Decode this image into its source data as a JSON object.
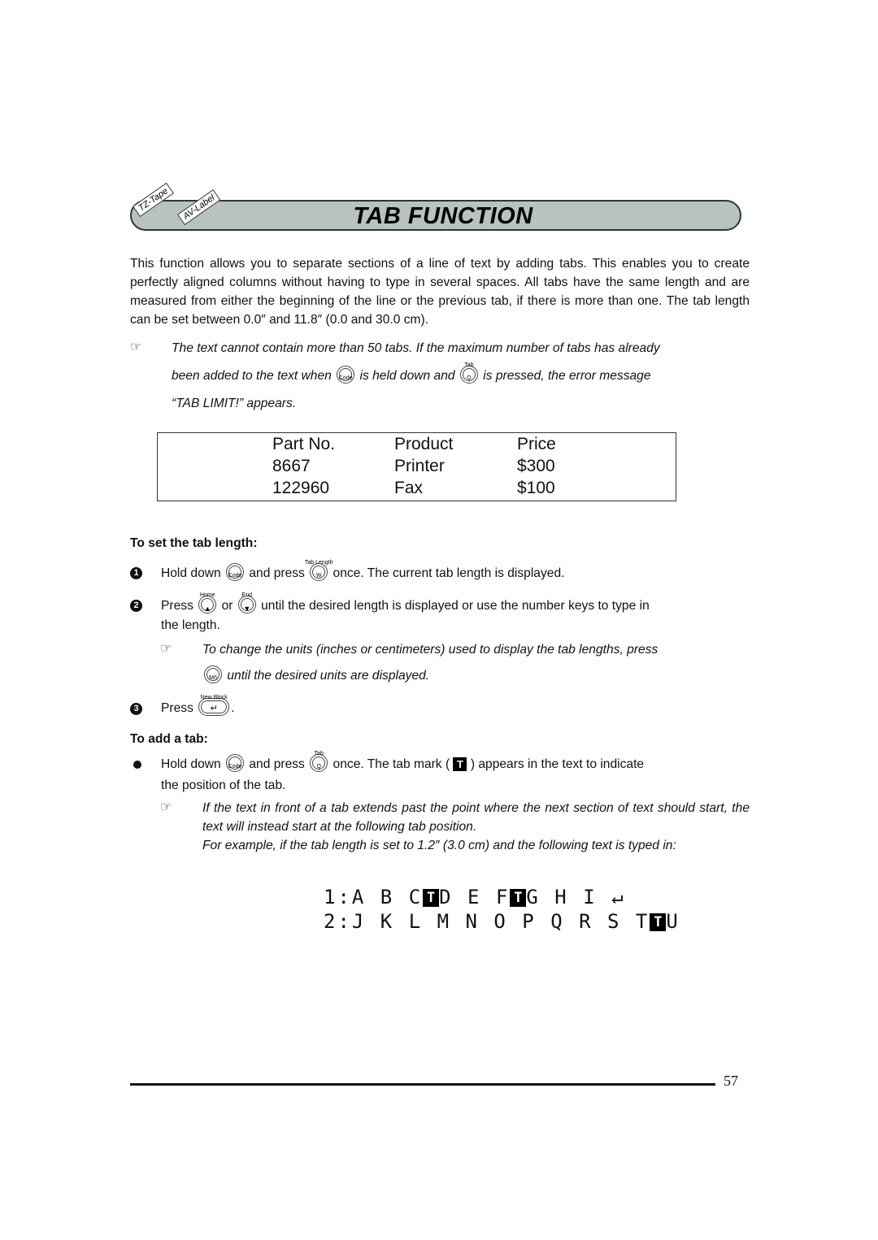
{
  "header": {
    "title": "TAB FUNCTION",
    "tags": [
      "TZ-Tape",
      "AV-Label"
    ]
  },
  "intro": "This function allows you to separate sections of a line of text by adding tabs. This enables you to create perfectly aligned columns without having to type in several spaces. All tabs have the same length and are measured from either the beginning of the line or the previous tab, if there is more than one. The tab length can be set between 0.0″ and 11.8″ (0.0 and 30.0 cm).",
  "note1": {
    "part1": "The text cannot contain more than 50 tabs. If the maximum number of tabs has already",
    "part2": "been added to the text when",
    "part3": "is held down and",
    "part4": "is pressed, the error message",
    "part5": "“TAB LIMIT!” appears."
  },
  "keys": {
    "code": "Code",
    "q": "Q",
    "q_sup": "Tab",
    "w": "W",
    "w_sup": "Tab Length",
    "up_sup": "Home",
    "down_sup": "End",
    "mn": "Mñ",
    "enter_sup": "New Block",
    "enter": "↵",
    "up": "▲",
    "down": "▼"
  },
  "example_table": {
    "headers": [
      "Part No.",
      "Product",
      "Price"
    ],
    "rows": [
      [
        "8667",
        "Printer",
        "$300"
      ],
      [
        "122960",
        "Fax",
        "$100"
      ]
    ]
  },
  "set_length": {
    "heading": "To set the tab length:",
    "step1": {
      "num": "1",
      "a": "Hold down",
      "b": "and press",
      "c": "once. The current tab length is displayed."
    },
    "step2": {
      "num": "2",
      "a": "Press",
      "b": "or",
      "c": "until the desired length is displayed or use the number keys to type in",
      "d": "the length."
    },
    "note": {
      "a": "To change the units (inches or centimeters) used to display the tab lengths, press",
      "b": "until the desired units are displayed."
    },
    "step3": {
      "num": "3",
      "a": "Press",
      "b": "."
    }
  },
  "add_tab": {
    "heading": "To add a tab:",
    "bullet": {
      "a": "Hold down",
      "b": "and press",
      "c": "once. The tab mark (",
      "d": ") appears in the text to indicate",
      "e": "the position of the tab."
    },
    "tab_glyph": "T",
    "note": {
      "a": "If the text in front of a tab extends past the point where the next section of text should start, the text will instead start at the following tab position.",
      "b": "For example, if the tab length is set to 1.2″ (3.0 cm) and the following text is typed in:"
    }
  },
  "display_example": {
    "line1": {
      "prefix": "1:",
      "seg1": "A B C",
      "seg2": "D E F",
      "seg3": "G H I",
      "end": "↵"
    },
    "line2": {
      "prefix": "2:",
      "seg1": "J K L M N O P Q R S T",
      "seg2": "U"
    }
  },
  "footer": {
    "page": "57"
  }
}
